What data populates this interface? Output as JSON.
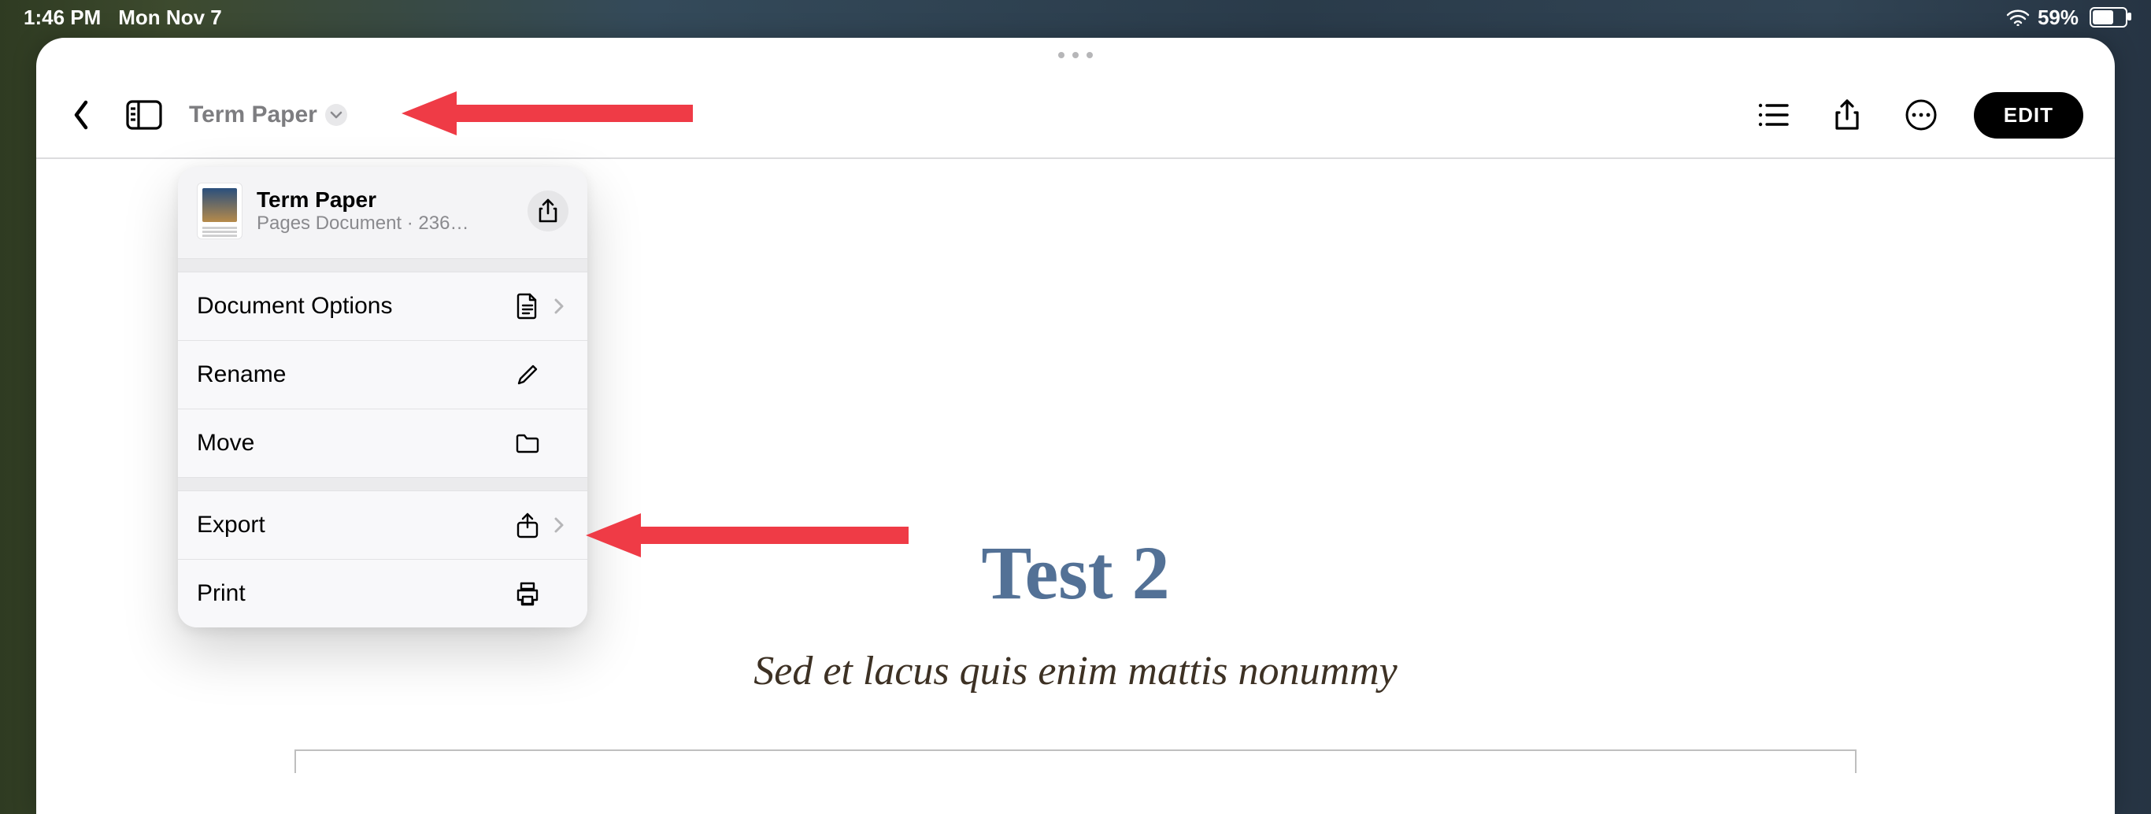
{
  "status_bar": {
    "time": "1:46 PM",
    "date": "Mon Nov 7",
    "battery_percent": "59%"
  },
  "toolbar": {
    "document_name": "Term Paper",
    "edit_label": "EDIT"
  },
  "popover": {
    "title": "Term Paper",
    "subtitle": "Pages Document · 236…",
    "group1": [
      {
        "label": "Document Options",
        "icon": "doc-icon",
        "chevron": true
      },
      {
        "label": "Rename",
        "icon": "pencil-icon",
        "chevron": false
      },
      {
        "label": "Move",
        "icon": "folder-icon",
        "chevron": false
      }
    ],
    "group2": [
      {
        "label": "Export",
        "icon": "export-icon",
        "chevron": true
      },
      {
        "label": "Print",
        "icon": "printer-icon",
        "chevron": false
      }
    ]
  },
  "document_body": {
    "title": "Test 2",
    "subtitle": "Sed et lacus quis enim mattis nonummy"
  }
}
